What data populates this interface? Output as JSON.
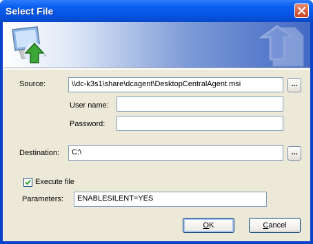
{
  "window": {
    "title": "Select File"
  },
  "banner": {
    "left_icon": "computer-upload-icon",
    "right_icon": "document-upload-icon"
  },
  "form": {
    "source_label": "Source:",
    "source_value": "\\\\dc-k3s1\\share\\dcagent\\DesktopCentralAgent.msi",
    "username_label": "User name:",
    "username_value": "",
    "password_label": "Password:",
    "password_value": "",
    "destination_label": "Destination:",
    "destination_value": "C:\\",
    "browse_label": "...",
    "execute_label": "Execute file",
    "execute_checked": true,
    "parameters_label": "Parameters:",
    "parameters_value": "ENABLESILENT=YES"
  },
  "buttons": {
    "ok_label": "OK",
    "ok_underline": "O",
    "ok_rest": "K",
    "cancel_label": "Cancel",
    "cancel_underline": "C",
    "cancel_rest": "ancel"
  },
  "colors": {
    "titlebar": "#0a5ff0",
    "dialog_bg": "#ece9d8",
    "field_border": "#7f9db9"
  }
}
